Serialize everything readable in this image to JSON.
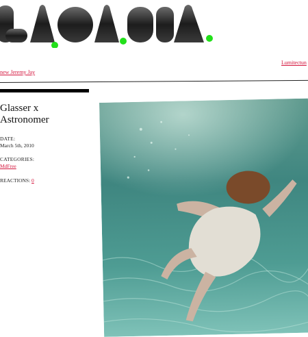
{
  "header": {
    "logo_text": "LAGASTA",
    "nav_left_link": "new Jeremy Jay",
    "nav_right_link": "Lumitectun"
  },
  "post": {
    "title_line1": "Glasser x",
    "title_line2": "Astronomer",
    "date_label": "DATE:",
    "date_value": "March 5th, 2010",
    "categories_label": "CATEGORIES:",
    "categories_value": "MdFree",
    "reactions_label": "REACTIONS:",
    "reactions_value": "0"
  },
  "colors": {
    "accent": "#d4143c",
    "dot_green": "#22e01a",
    "logo_gray": "#2a2a2a"
  },
  "image": {
    "subject": "underwater-swimmer-photo"
  }
}
